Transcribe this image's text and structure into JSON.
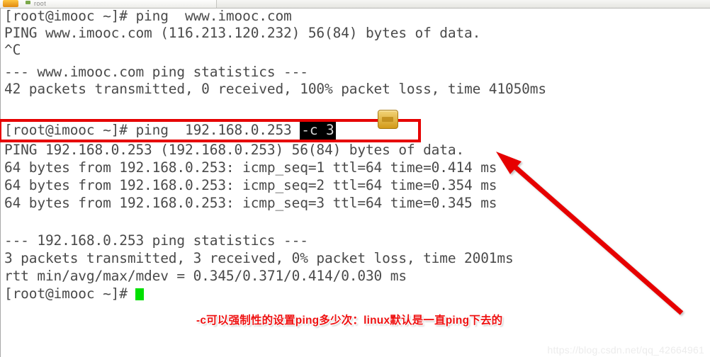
{
  "window": {
    "title": "root",
    "icon": "terminal-icon",
    "status_dot": "connected-indicator"
  },
  "terminal": {
    "prompt": "[root@imooc ~]#",
    "lines": [
      {
        "id": "l1",
        "text": "[root@imooc ~]# ping  www.imooc.com"
      },
      {
        "id": "l2",
        "text": "PING www.imooc.com (116.213.120.232) 56(84) bytes of data."
      },
      {
        "id": "l3",
        "text": "^C"
      },
      {
        "id": "l4",
        "text": "--- www.imooc.com ping statistics ---"
      },
      {
        "id": "l5",
        "text": "42 packets transmitted, 0 received, 100% packet loss, time 41050ms"
      },
      {
        "id": "l7",
        "text": "PING 192.168.0.253 (192.168.0.253) 56(84) bytes of data."
      },
      {
        "id": "l8",
        "text": "64 bytes from 192.168.0.253: icmp_seq=1 ttl=64 time=0.414 ms"
      },
      {
        "id": "l9",
        "text": "64 bytes from 192.168.0.253: icmp_seq=2 ttl=64 time=0.354 ms"
      },
      {
        "id": "l10",
        "text": "64 bytes from 192.168.0.253: icmp_seq=3 ttl=64 time=0.345 ms"
      },
      {
        "id": "l12",
        "text": "--- 192.168.0.253 ping statistics ---"
      },
      {
        "id": "l13",
        "text": "3 packets transmitted, 3 received, 0% packet loss, time 2001ms"
      },
      {
        "id": "l14",
        "text": "rtt min/avg/max/mdev = 0.345/0.371/0.414/0.030 ms"
      }
    ],
    "highlighted_command": {
      "prefix": "[root@imooc ~]# ping  192.168.0.253 ",
      "selected_option": "-c 3"
    },
    "last_prompt": "[root@imooc ~]# "
  },
  "annotations": {
    "caption": "-c可以强制性的设置ping多少次：linux默认是一直ping下去的",
    "box_color": "#e60000",
    "arrow_color": "#e60000",
    "caption_color": "#ee1111"
  },
  "watermark": {
    "text": "https://blog.csdn.net/qq_42664961"
  }
}
